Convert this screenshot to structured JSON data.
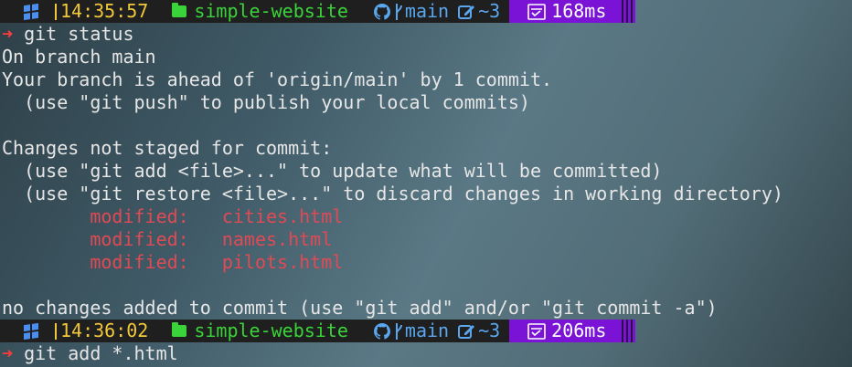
{
  "prompts": [
    {
      "time": "14:35:57",
      "directory": "simple-website",
      "branch": "main",
      "changes": "~3",
      "duration": "168ms",
      "command": "git status"
    },
    {
      "time": "14:36:02",
      "directory": "simple-website",
      "branch": "main",
      "changes": "~3",
      "duration": "206ms",
      "command": "git add *.html"
    }
  ],
  "prompt_arrow": "➜",
  "output": {
    "line1": "On branch main",
    "line2": "Your branch is ahead of 'origin/main' by 1 commit.",
    "line3": "  (use \"git push\" to publish your local commits)",
    "line4": "Changes not staged for commit:",
    "line5": "  (use \"git add <file>...\" to update what will be committed)",
    "line6": "  (use \"git restore <file>...\" to discard changes in working directory)",
    "modified": [
      "        modified:   cities.html",
      "        modified:   names.html",
      "        modified:   pilots.html"
    ],
    "line_final": "no changes added to commit (use \"git add\" and/or \"git commit -a\")"
  },
  "colors": {
    "time": "#f2c83b",
    "directory": "#3ad33a",
    "git": "#5aa7f0",
    "duration_bg": "#7b13d6",
    "arrow": "#ff3b3b",
    "modified": "#e04a55"
  },
  "icons": [
    "windows-icon",
    "folder-icon",
    "github-icon",
    "branch-icon",
    "edit-icon",
    "stopwatch-icon"
  ]
}
